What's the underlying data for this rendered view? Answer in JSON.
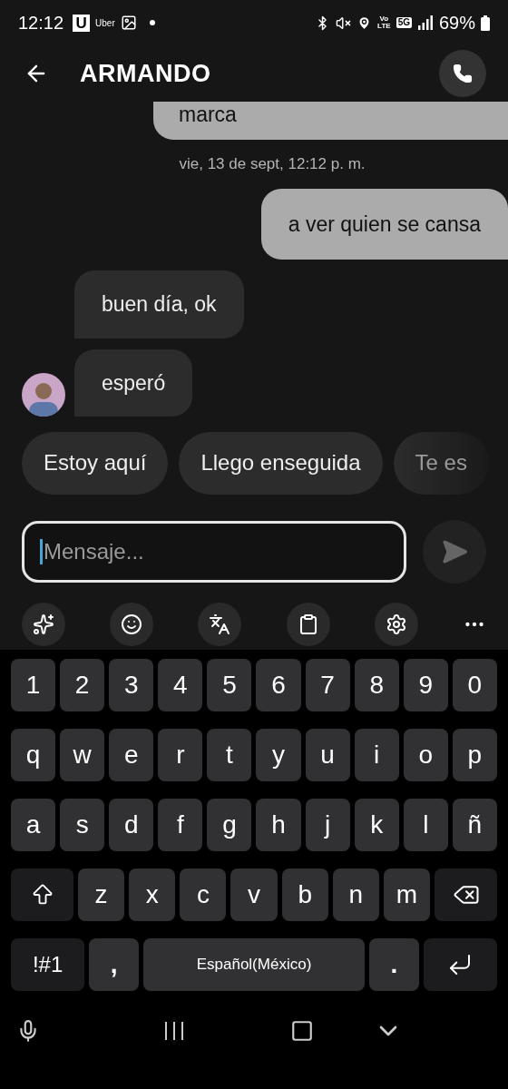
{
  "status_bar": {
    "time": "12:12",
    "app_logo": "U",
    "app_label": "Uber",
    "volte_top": "Vo",
    "volte_bottom": "LTE",
    "network": "5G",
    "battery": "69%"
  },
  "header": {
    "title": "ARMANDO"
  },
  "messages": [
    {
      "kind": "outgoing",
      "text": "marca"
    },
    {
      "kind": "timestamp",
      "text": "vie, 13 de sept, 12:12 p. m."
    },
    {
      "kind": "outgoing",
      "text": "a ver quien se cansa"
    },
    {
      "kind": "incoming",
      "text": "buen día, ok",
      "avatar": false
    },
    {
      "kind": "incoming",
      "text": "esperó",
      "avatar": true
    }
  ],
  "suggestions": [
    {
      "text": "Estoy aquí",
      "faded": false
    },
    {
      "text": "Llego enseguida",
      "faded": false
    },
    {
      "text": "Te es",
      "faded": true
    }
  ],
  "composer": {
    "placeholder": "Mensaje...",
    "send_enabled": false
  },
  "keyboard": {
    "rows": [
      {
        "keys": [
          {
            "kind": "char",
            "label": "1"
          },
          {
            "kind": "char",
            "label": "2"
          },
          {
            "kind": "char",
            "label": "3"
          },
          {
            "kind": "char",
            "label": "4"
          },
          {
            "kind": "char",
            "label": "5"
          },
          {
            "kind": "char",
            "label": "6"
          },
          {
            "kind": "char",
            "label": "7"
          },
          {
            "kind": "char",
            "label": "8"
          },
          {
            "kind": "char",
            "label": "9"
          },
          {
            "kind": "char",
            "label": "0"
          }
        ]
      },
      {
        "keys": [
          {
            "kind": "char",
            "label": "q"
          },
          {
            "kind": "char",
            "label": "w"
          },
          {
            "kind": "char",
            "label": "e"
          },
          {
            "kind": "char",
            "label": "r"
          },
          {
            "kind": "char",
            "label": "t"
          },
          {
            "kind": "char",
            "label": "y"
          },
          {
            "kind": "char",
            "label": "u"
          },
          {
            "kind": "char",
            "label": "i"
          },
          {
            "kind": "char",
            "label": "o"
          },
          {
            "kind": "char",
            "label": "p"
          }
        ]
      },
      {
        "keys": [
          {
            "kind": "char",
            "label": "a"
          },
          {
            "kind": "char",
            "label": "s"
          },
          {
            "kind": "char",
            "label": "d"
          },
          {
            "kind": "char",
            "label": "f"
          },
          {
            "kind": "char",
            "label": "g"
          },
          {
            "kind": "char",
            "label": "h"
          },
          {
            "kind": "char",
            "label": "j"
          },
          {
            "kind": "char",
            "label": "k"
          },
          {
            "kind": "char",
            "label": "l"
          },
          {
            "kind": "char",
            "label": "ñ"
          }
        ]
      },
      {
        "keys": [
          {
            "kind": "shift"
          },
          {
            "kind": "char",
            "label": "z"
          },
          {
            "kind": "char",
            "label": "x"
          },
          {
            "kind": "char",
            "label": "c"
          },
          {
            "kind": "char",
            "label": "v"
          },
          {
            "kind": "char",
            "label": "b"
          },
          {
            "kind": "char",
            "label": "n"
          },
          {
            "kind": "char",
            "label": "m"
          },
          {
            "kind": "backspace"
          }
        ]
      },
      {
        "keys": [
          {
            "kind": "symbols",
            "label": "!#1"
          },
          {
            "kind": "punct",
            "label": ","
          },
          {
            "kind": "space",
            "label": "Español(México)"
          },
          {
            "kind": "punct",
            "label": "."
          },
          {
            "kind": "enter"
          }
        ]
      }
    ]
  }
}
